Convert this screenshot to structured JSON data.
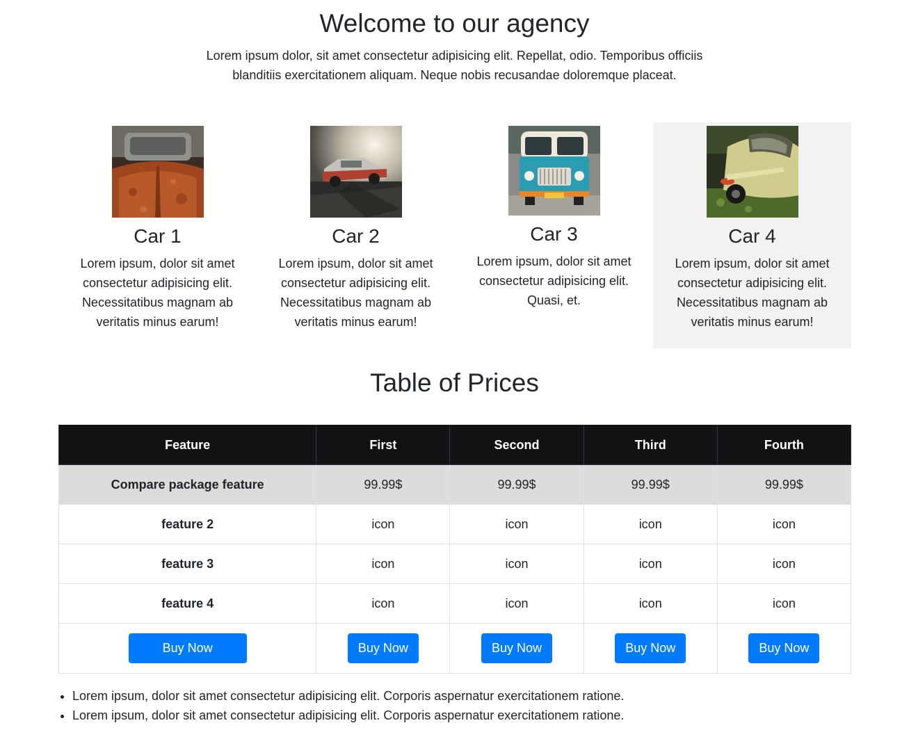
{
  "hero": {
    "title": "Welcome to our agency",
    "text": "Lorem ipsum dolor, sit amet consectetur adipisicing elit. Repellat, odio. Temporibus officiis blanditiis exercitationem aliquam. Neque nobis recusandae doloremque placeat."
  },
  "cars": [
    {
      "title": "Car 1",
      "text": "Lorem ipsum, dolor sit amet consectetur adipisicing elit. Necessitatibus magnam ab veritatis minus earum!",
      "image_icon": "rusty-car-hood-photo"
    },
    {
      "title": "Car 2",
      "text": "Lorem ipsum, dolor sit amet consectetur adipisicing elit. Necessitatibus magnam ab veritatis minus earum!",
      "image_icon": "classic-car-sunset-photo"
    },
    {
      "title": "Car 3",
      "text": "Lorem ipsum, dolor sit amet consectetur adipisicing elit. Quasi, et.",
      "image_icon": "vintage-bus-photo"
    },
    {
      "title": "Car 4",
      "text": "Lorem ipsum, dolor sit amet consectetur adipisicing elit. Necessitatibus magnam ab veritatis minus earum!",
      "image_icon": "vintage-sports-car-photo"
    }
  ],
  "prices": {
    "title": "Table of Prices",
    "headers": [
      "Feature",
      "First",
      "Second",
      "Third",
      "Fourth"
    ],
    "rows": [
      {
        "feature": "Compare package feature",
        "cells": [
          "99.99$",
          "99.99$",
          "99.99$",
          "99.99$"
        ]
      },
      {
        "feature": "feature 2",
        "cells": [
          "icon",
          "icon",
          "icon",
          "icon"
        ]
      },
      {
        "feature": "feature 3",
        "cells": [
          "icon",
          "icon",
          "icon",
          "icon"
        ]
      },
      {
        "feature": "feature 4",
        "cells": [
          "icon",
          "icon",
          "icon",
          "icon"
        ]
      }
    ],
    "buy_label": "Buy Now"
  },
  "bullets": [
    "Lorem ipsum, dolor sit amet consectetur adipisicing elit. Corporis aspernatur exercitationem ratione.",
    "Lorem ipsum, dolor sit amet consectetur adipisicing elit. Corporis aspernatur exercitationem ratione."
  ],
  "colors": {
    "primary_button": "#007bff",
    "table_header": "#111214",
    "highlight_row": "#dcdcdc",
    "highlight_card": "#f1f2f1"
  }
}
